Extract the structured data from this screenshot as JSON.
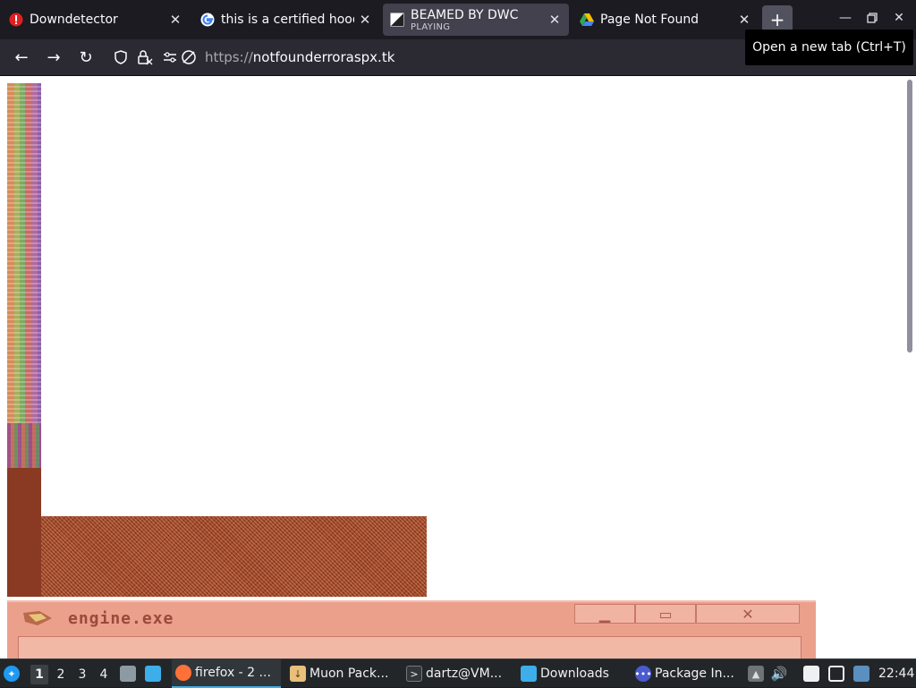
{
  "tabs": [
    {
      "title": "Downdetector",
      "favicon": "alert-icon"
    },
    {
      "title": "this is a certified hood",
      "favicon": "google-icon"
    },
    {
      "title": "BEAMED BY DWC",
      "subtitle": "PLAYING",
      "favicon": "beamed-icon",
      "active": true
    },
    {
      "title": "Page Not Found",
      "favicon": "drive-icon"
    }
  ],
  "new_tab": "+",
  "tooltip": "Open a new tab (Ctrl+T)",
  "url": {
    "scheme": "https://",
    "host": "notfounderroraspx.tk"
  },
  "engine_window": {
    "title": "engine.exe"
  },
  "taskbar": {
    "desktops": [
      "1",
      "2",
      "3",
      "4"
    ],
    "tasks": [
      {
        "label": "firefox - 2 ...",
        "icon": "firefox-icon"
      },
      {
        "label": "Muon Pack...",
        "icon": "package-icon"
      },
      {
        "label": "dartz@VM...",
        "icon": "terminal-icon"
      },
      {
        "label": "Downloads",
        "icon": "folder-icon"
      },
      {
        "label": "Package In...",
        "icon": "installer-icon"
      }
    ],
    "clock": "22:44"
  }
}
